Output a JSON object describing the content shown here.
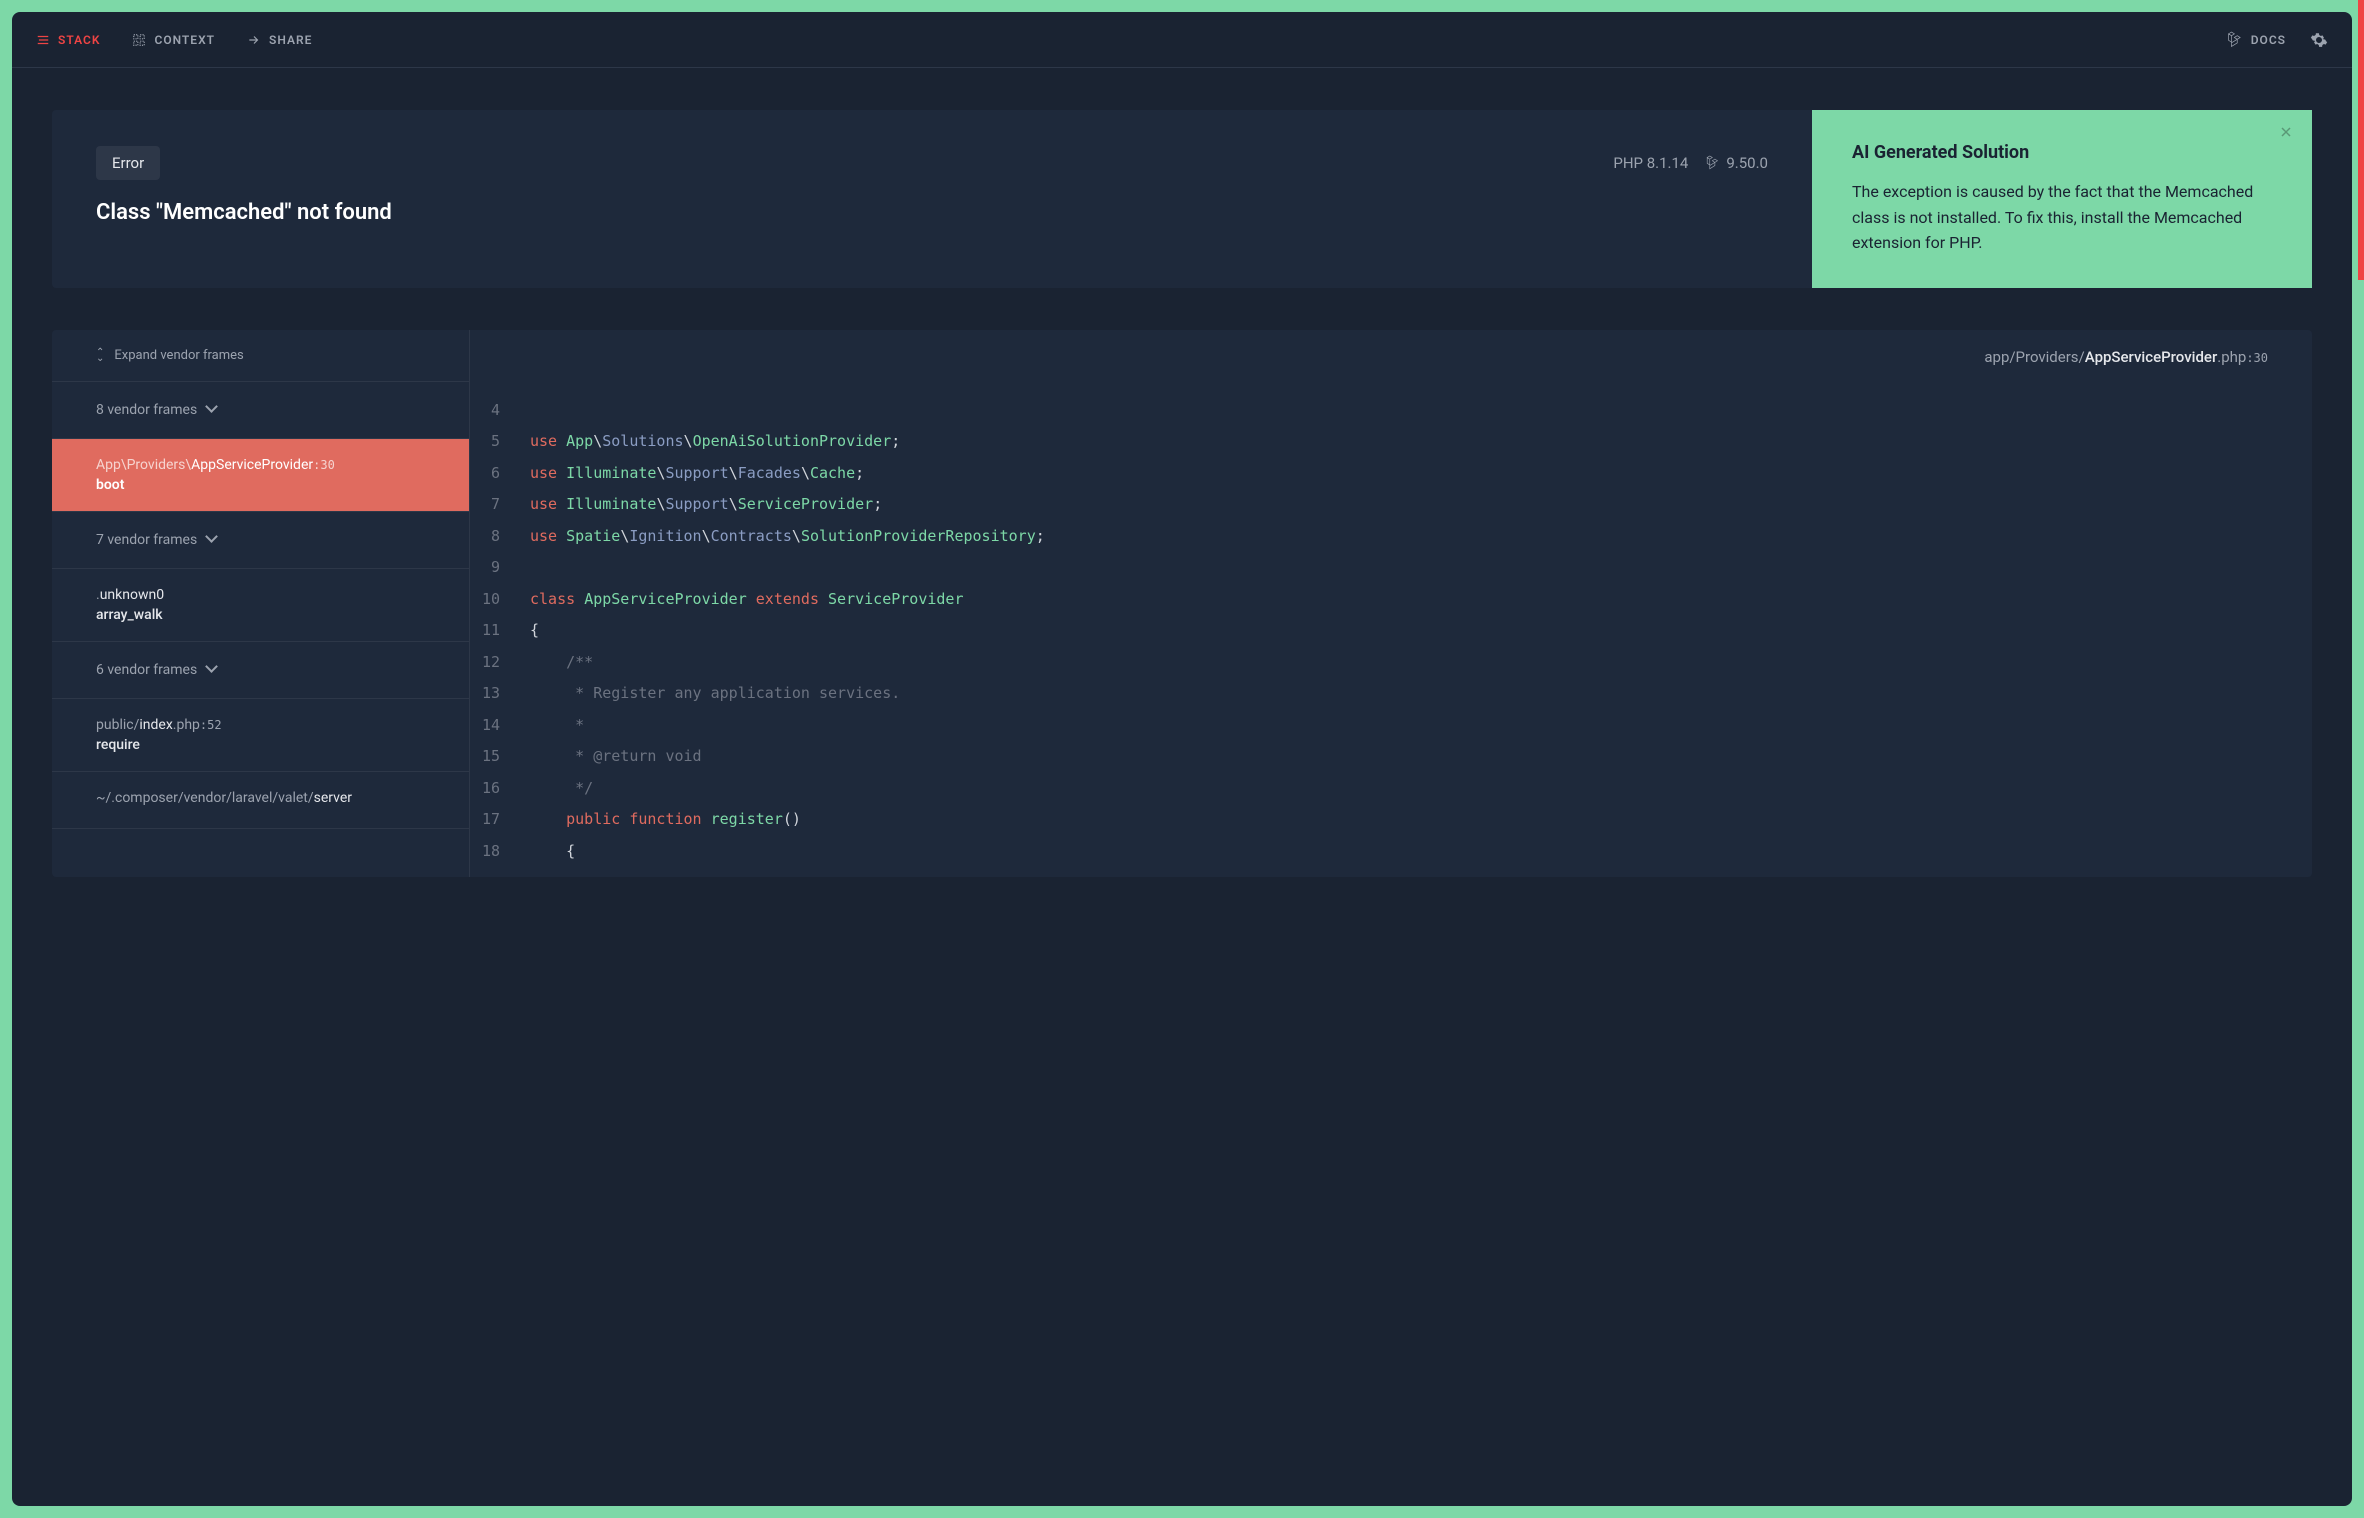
{
  "nav": {
    "stack": "STACK",
    "context": "CONTEXT",
    "share": "SHARE",
    "docs": "DOCS"
  },
  "error": {
    "badge": "Error",
    "php_version": "PHP 8.1.14",
    "laravel_version": "9.50.0",
    "title": "Class \"Memcached\" not found"
  },
  "ai": {
    "title": "AI Generated Solution",
    "body": "The exception is caused by the fact that the Memcached class is not installed. To fix this, install the Memcached extension for PHP."
  },
  "frames": {
    "expand_label": "Expand vendor frames",
    "groups": [
      {
        "count": 8,
        "label": "8 vendor frames"
      },
      {
        "count": 7,
        "label": "7 vendor frames"
      },
      {
        "count": 6,
        "label": "6 vendor frames"
      }
    ],
    "active": {
      "namespace": "App\\Providers\\",
      "class": "AppServiceProvider",
      "line": ":30",
      "method": "boot"
    },
    "entries": [
      {
        "path_prefix": ".",
        "path_main": "unknown0",
        "line": "",
        "method": "array_walk"
      },
      {
        "path_prefix": "public/",
        "path_main": "index",
        "path_suffix": ".php",
        "line": ":52",
        "method": "require"
      },
      {
        "path_prefix": "~/.composer/vendor/laravel/valet/",
        "path_main": "server",
        "path_suffix": "",
        "line": "",
        "method": ""
      }
    ]
  },
  "code": {
    "path_prefix": "app/Providers/",
    "path_main": "AppServiceProvider",
    "path_suffix": ".php",
    "path_line": ":30",
    "lines": [
      {
        "n": 4,
        "html": ""
      },
      {
        "n": 5,
        "html": "<span class='kw'>use</span> <span class='cls'>App</span>\\<span class='ns'>Solutions</span>\\<span class='cls'>OpenAiSolutionProvider</span>;"
      },
      {
        "n": 6,
        "html": "<span class='kw'>use</span> <span class='cls'>Illuminate</span>\\<span class='ns'>Support</span>\\<span class='ns'>Facades</span>\\<span class='cls'>Cache</span>;"
      },
      {
        "n": 7,
        "html": "<span class='kw'>use</span> <span class='cls'>Illuminate</span>\\<span class='ns'>Support</span>\\<span class='cls'>ServiceProvider</span>;"
      },
      {
        "n": 8,
        "html": "<span class='kw'>use</span> <span class='cls'>Spatie</span>\\<span class='ns'>Ignition</span>\\<span class='ns'>Contracts</span>\\<span class='cls'>SolutionProviderRepository</span>;"
      },
      {
        "n": 9,
        "html": ""
      },
      {
        "n": 10,
        "html": "<span class='kw'>class</span> <span class='cls'>AppServiceProvider</span> <span class='kw'>extends</span> <span class='cls'>ServiceProvider</span>"
      },
      {
        "n": 11,
        "html": "{"
      },
      {
        "n": 12,
        "html": "    <span class='cmt'>/**</span>"
      },
      {
        "n": 13,
        "html": "    <span class='cmt'> * Register any application services.</span>"
      },
      {
        "n": 14,
        "html": "    <span class='cmt'> *</span>"
      },
      {
        "n": 15,
        "html": "    <span class='cmt'> * @return void</span>"
      },
      {
        "n": 16,
        "html": "    <span class='cmt'> */</span>"
      },
      {
        "n": 17,
        "html": "    <span class='kw'>public</span> <span class='kw'>function</span> <span class='fn'>register</span>()"
      },
      {
        "n": 18,
        "html": "    {"
      }
    ]
  }
}
